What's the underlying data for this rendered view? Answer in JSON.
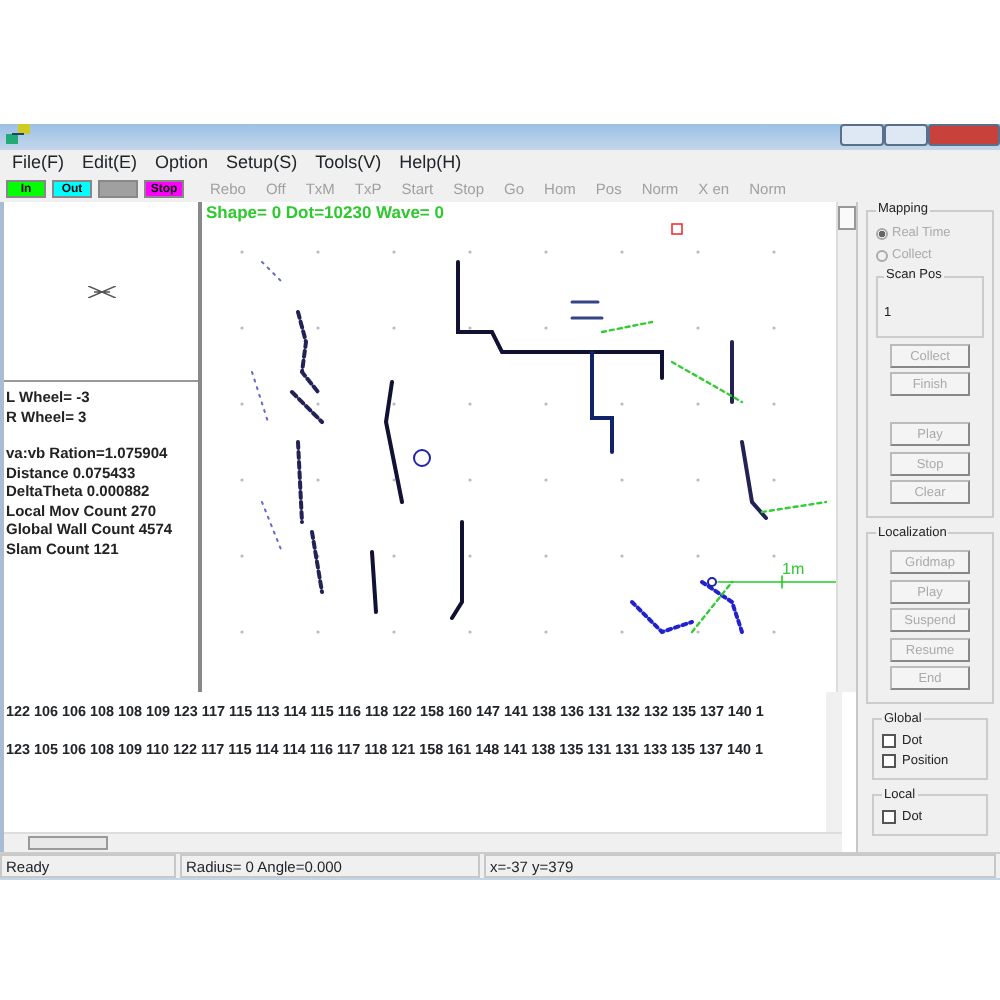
{
  "menu": [
    "File(F)",
    "Edit(E)",
    "Option",
    "Setup(S)",
    "Tools(V)",
    "Help(H)"
  ],
  "color_buttons": [
    {
      "label": "In",
      "color": "#00ff00"
    },
    {
      "label": "Out",
      "color": "#00ffff"
    },
    {
      "color": "#a0a0a0"
    },
    {
      "label": "Stop",
      "color": "#ff00ff"
    }
  ],
  "toolbar": [
    {
      "label": "Rebo",
      "disabled": true
    },
    {
      "label": "Off",
      "disabled": true
    },
    {
      "label": "TxM",
      "disabled": true
    },
    {
      "label": "TxP",
      "disabled": true
    },
    {
      "label": "Start",
      "disabled": true
    },
    {
      "label": "Stop",
      "disabled": true
    },
    {
      "label": "Go",
      "disabled": true
    },
    {
      "label": "Hom",
      "disabled": true
    },
    {
      "label": "Pos",
      "disabled": true
    },
    {
      "label": "Norm",
      "disabled": true
    },
    {
      "label": "X en",
      "disabled": true
    },
    {
      "label": "Norm",
      "disabled": true
    }
  ],
  "left_panel": {
    "wheels": [
      "L Wheel= -3",
      "R Wheel=  3"
    ],
    "stats": [
      "va:vb Ration=1.075904",
      "Distance 0.075433",
      "DeltaTheta 0.000882",
      "Local Mov Count 270",
      "Global Wall Count 4574",
      "Slam Count 121"
    ]
  },
  "map": {
    "info": "Shape= 0  Dot=10230  Wave= 0",
    "scale_label": "1m"
  },
  "data_rows": [
    "122   106 106 108 108 109 123 117 115 113 114 115 116 118 122 158 160 147 141 138 136 131 132 132 135 137 140 1",
    "123   105 106 108 109 110 122 117 115 114 114 116 117 118 121 158 161 148 141 138 135 131 131 133 135 137 140 1"
  ],
  "mapping": {
    "title": "Mapping",
    "radios": [
      {
        "label": "Real Time",
        "selected": true,
        "disabled": true
      },
      {
        "label": "Collect",
        "selected": false,
        "disabled": true
      }
    ],
    "scan_pos": {
      "label": "Scan Pos",
      "value": "1"
    },
    "buttons": [
      {
        "label": "Collect",
        "disabled": true
      },
      {
        "label": "Finish",
        "disabled": true
      },
      {
        "label": "Play",
        "disabled": true
      },
      {
        "label": "Stop",
        "disabled": true
      },
      {
        "label": "Clear",
        "disabled": true
      }
    ]
  },
  "localization": {
    "title": "Localization",
    "buttons": [
      {
        "label": "Gridmap",
        "disabled": true
      },
      {
        "label": "Play",
        "disabled": true
      },
      {
        "label": "Suspend",
        "disabled": true
      },
      {
        "label": "Resume",
        "disabled": true
      },
      {
        "label": "End",
        "disabled": true
      }
    ]
  },
  "global": {
    "title": "Global",
    "checkboxes": [
      {
        "label": "Dot",
        "checked": false
      },
      {
        "label": "Position",
        "checked": false
      }
    ]
  },
  "local": {
    "title": "Local",
    "checkboxes": [
      {
        "label": "Dot",
        "checked": false
      }
    ]
  },
  "status_bar": [
    "Ready",
    "Radius=  0 Angle=0.000",
    "x=-37 y=379"
  ]
}
